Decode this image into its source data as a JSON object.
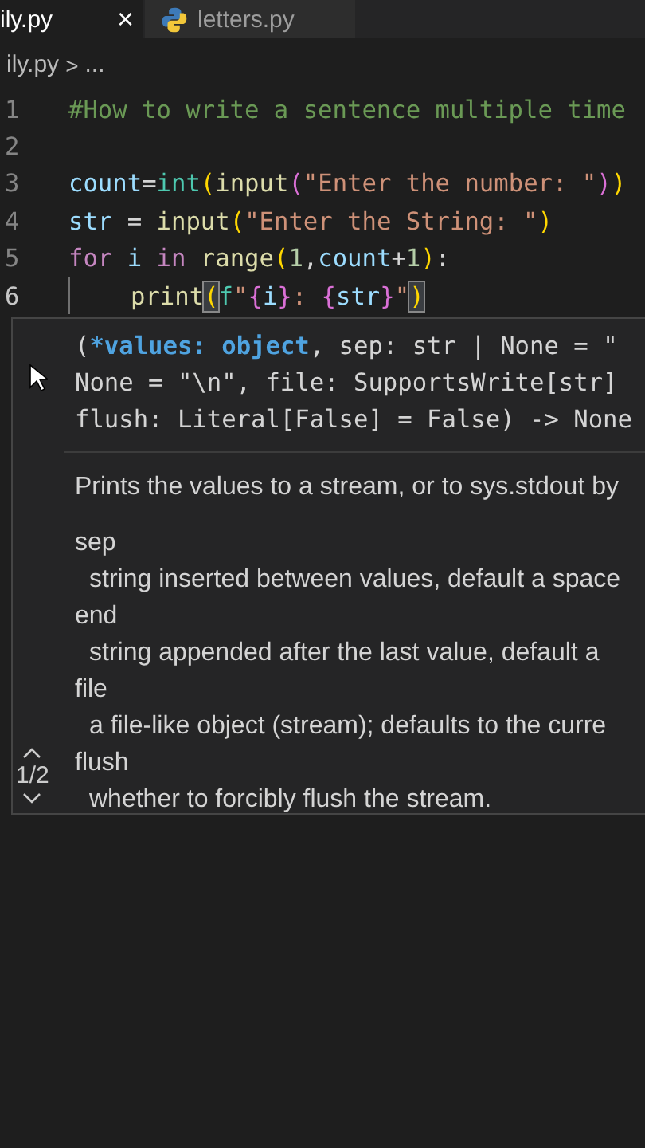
{
  "tabs": [
    {
      "label": "ily.py",
      "selected": true,
      "close": "×"
    },
    {
      "label": "letters.py",
      "selected": false
    }
  ],
  "breadcrumb": {
    "file": "ily.py",
    "separator": ">",
    "rest": "..."
  },
  "code": [
    {
      "number": "1",
      "current": false,
      "indent": false,
      "tokens": [
        {
          "kind": "comment",
          "text": "#How to write a sentence multiple time"
        }
      ]
    },
    {
      "number": "2",
      "current": false,
      "indent": false
    },
    {
      "number": "3",
      "current": false,
      "indent": false,
      "tokens": [
        {
          "kind": "variable",
          "text": "count"
        },
        {
          "kind": "plain",
          "text": "="
        },
        {
          "kind": "type",
          "text": "int"
        },
        {
          "kind": "bracket1",
          "text": "("
        },
        {
          "kind": "function",
          "text": "input"
        },
        {
          "kind": "bracket2",
          "text": "("
        },
        {
          "kind": "string",
          "text": "\"Enter the number: \""
        },
        {
          "kind": "bracket2",
          "text": ")"
        },
        {
          "kind": "bracket1",
          "text": ")"
        }
      ]
    },
    {
      "number": "4",
      "current": false,
      "indent": false,
      "tokens": [
        {
          "kind": "variable",
          "text": "str"
        },
        {
          "kind": "plain",
          "text": " = "
        },
        {
          "kind": "function",
          "text": "input"
        },
        {
          "kind": "bracket1",
          "text": "("
        },
        {
          "kind": "string",
          "text": "\"Enter the String: \""
        },
        {
          "kind": "bracket1",
          "text": ")"
        }
      ]
    },
    {
      "number": "5",
      "current": false,
      "indent": false,
      "tokens": [
        {
          "kind": "keyword",
          "text": "for"
        },
        {
          "kind": "variable",
          "text": " i "
        },
        {
          "kind": "keyword",
          "text": "in"
        },
        {
          "kind": "function",
          "text": " range"
        },
        {
          "kind": "bracket1",
          "text": "("
        },
        {
          "kind": "number",
          "text": "1"
        },
        {
          "kind": "plain",
          "text": ","
        },
        {
          "kind": "variable",
          "text": "count"
        },
        {
          "kind": "plain",
          "text": "+"
        },
        {
          "kind": "number",
          "text": "1"
        },
        {
          "kind": "bracket1",
          "text": ")"
        },
        {
          "kind": "plain",
          "text": ":"
        }
      ]
    },
    {
      "number": "6",
      "current": true,
      "indent": true,
      "tokens": [
        {
          "kind": "function",
          "text": "print"
        },
        {
          "kind": "match",
          "text": "("
        },
        {
          "kind": "type",
          "text": "f"
        },
        {
          "kind": "string",
          "text": "\""
        },
        {
          "kind": "brace",
          "text": "{"
        },
        {
          "kind": "variable",
          "text": "i"
        },
        {
          "kind": "brace",
          "text": "}"
        },
        {
          "kind": "string",
          "text": ": "
        },
        {
          "kind": "brace",
          "text": "{"
        },
        {
          "kind": "variable",
          "text": "str"
        },
        {
          "kind": "brace",
          "text": "}"
        },
        {
          "kind": "string",
          "text": "\""
        },
        {
          "kind": "match",
          "text": ")"
        }
      ]
    }
  ],
  "hover": {
    "signature": [
      [
        {
          "kind": "plain",
          "text": "("
        },
        {
          "kind": "active",
          "text": "*values: object"
        },
        {
          "kind": "plain",
          "text": ", sep: str | None = \""
        }
      ],
      [
        {
          "kind": "plain",
          "text": "None = \"\\n\", file: SupportsWrite[str]"
        }
      ],
      [
        {
          "kind": "plain",
          "text": "flush: Literal[False] = False) -> None"
        }
      ]
    ],
    "description": "Prints the values to a stream, or to sys.stdout by",
    "params": [
      {
        "name": "sep",
        "text": "string inserted between values, default a space"
      },
      {
        "name": "end",
        "text": "string appended after the last value, default a"
      },
      {
        "name": "file",
        "text": "a file-like object (stream); defaults to the curre"
      },
      {
        "name": "flush",
        "text": "whether to forcibly flush the stream."
      }
    ],
    "pager": "1/2"
  }
}
